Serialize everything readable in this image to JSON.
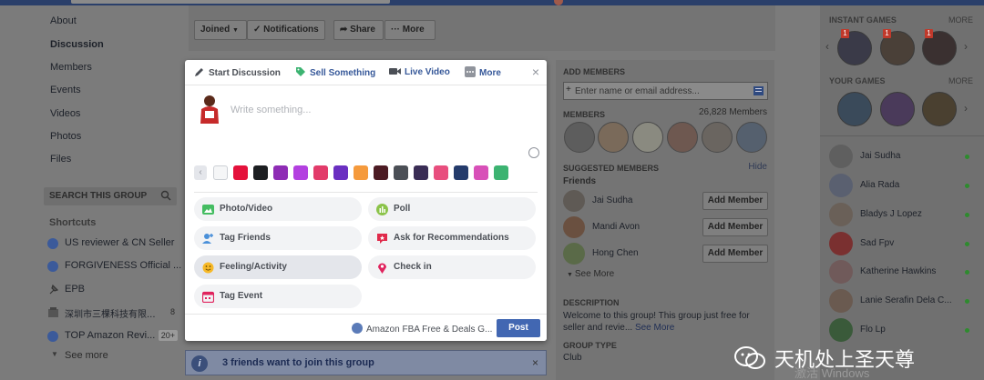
{
  "left_nav": {
    "items": [
      {
        "label": "About",
        "active": false
      },
      {
        "label": "Discussion",
        "active": true
      },
      {
        "label": "Members",
        "active": false
      },
      {
        "label": "Events",
        "active": false
      },
      {
        "label": "Videos",
        "active": false
      },
      {
        "label": "Photos",
        "active": false
      },
      {
        "label": "Files",
        "active": false
      }
    ],
    "search_placeholder": "Search this group",
    "shortcuts_heading": "Shortcuts",
    "shortcuts": [
      {
        "label": "US reviewer & CN Seller",
        "count": ""
      },
      {
        "label": "FORGIVENESS Official ...",
        "count": ""
      },
      {
        "label": "EPB",
        "count": ""
      },
      {
        "label": "深圳市三棵科技有限...",
        "count": "8"
      },
      {
        "label": "TOP Amazon Revi...",
        "count": "20+"
      }
    ],
    "see_more": "See more"
  },
  "action_bar": {
    "joined": "Joined",
    "notifications": "Notifications",
    "share": "Share",
    "more": "More"
  },
  "composer": {
    "tabs": {
      "start_discussion": "Start Discussion",
      "sell_something": "Sell Something",
      "live_video": "Live Video",
      "more": "More"
    },
    "close": "×",
    "placeholder": "Write something...",
    "swatch_colors": [
      "#f5f6f7",
      "#e4113b",
      "#1c1e21",
      "#8e2cb5",
      "#b340e0",
      "#e23b6a",
      "#6a2fc1",
      "#f59a3c",
      "#4c1b23",
      "#4b4f56",
      "#3a2d55",
      "#e84e7e",
      "#243b6b",
      "#d850b8",
      "#3cb371"
    ],
    "options": [
      {
        "label": "Photo/Video",
        "icon": "photo-icon"
      },
      {
        "label": "Poll",
        "icon": "poll-icon"
      },
      {
        "label": "Tag Friends",
        "icon": "tag-friends-icon"
      },
      {
        "label": "Ask for Recommendations",
        "icon": "recommendations-icon"
      },
      {
        "label": "Feeling/Activity",
        "icon": "feeling-icon"
      },
      {
        "label": "Check in",
        "icon": "checkin-icon"
      },
      {
        "label": "Tag Event",
        "icon": "event-icon"
      }
    ],
    "audience": "Amazon FBA Free & Deals G...",
    "post": "Post"
  },
  "friends_banner": {
    "text": "3 friends want to join this group",
    "close": "×"
  },
  "group_panel": {
    "add_members_heading": "ADD MEMBERS",
    "add_members_placeholder": "Enter name or email address...",
    "members_heading": "MEMBERS",
    "members_count": "26,828 Members",
    "suggested_heading": "SUGGESTED MEMBERS",
    "hide": "Hide",
    "friends_label": "Friends",
    "suggested": [
      {
        "name": "Jai Sudha",
        "button": "Add Member"
      },
      {
        "name": "Mandi Avon",
        "button": "Add Member"
      },
      {
        "name": "Hong Chen",
        "button": "Add Member"
      }
    ],
    "see_more": "See More",
    "description_heading": "DESCRIPTION",
    "description": "Welcome to this group! This group just free for seller and revie...",
    "description_more": "See More",
    "group_type_heading": "GROUP TYPE",
    "group_type": "Club"
  },
  "right_column": {
    "instant_games": "INSTANT GAMES",
    "instant_more": "MORE",
    "your_games": "YOUR GAMES",
    "your_more": "MORE",
    "badges": [
      "1",
      "1",
      "1"
    ],
    "contacts": [
      "Jai Sudha",
      "Alia Rada",
      "Bladys J Lopez",
      "Sad Fpv",
      "Katherine Hawkins",
      "Lanie Serafin Dela C...",
      "Flo Lp"
    ]
  },
  "watermark": {
    "text": "天机处上圣天尊",
    "windows": "激活 Windows"
  }
}
